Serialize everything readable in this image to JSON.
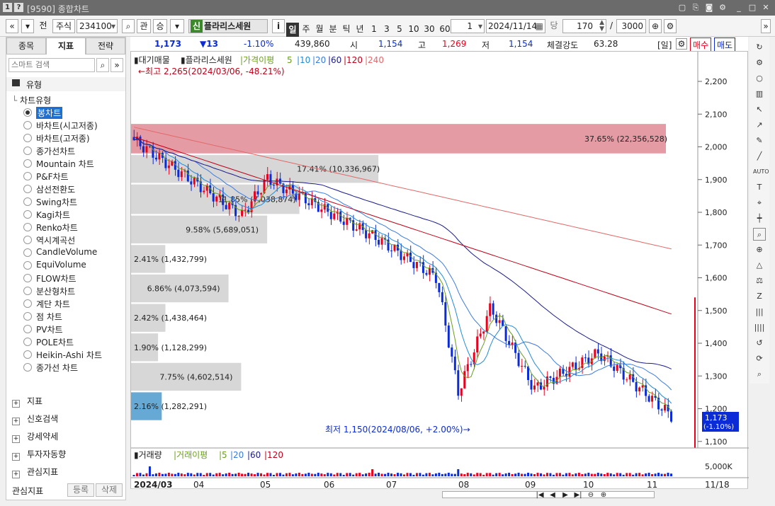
{
  "window": {
    "code": "[9590]",
    "title": "종합차트"
  },
  "toolbar": {
    "nav_prev": "«",
    "nav_down": "»",
    "chk_jeon": "전",
    "type": "주식",
    "code_value": "234100",
    "btn_gwan": "관",
    "btn_seung": "승",
    "stock_badge": "신",
    "stock_name": "플라리스세원",
    "info_btn": "i",
    "periods": [
      "일",
      "주",
      "월",
      "분",
      "틱",
      "년"
    ],
    "active_period": "일",
    "minutes": [
      "1",
      "3",
      "5",
      "10",
      "30",
      "60"
    ],
    "interval_value": "1",
    "date_value": "2024/11/14",
    "dang_label": "당",
    "count_value": "170",
    "slash": "/",
    "total_value": "3000"
  },
  "info": {
    "price": "1,173",
    "change": "▼13",
    "change_pct": "-1.10%",
    "volume": "439,860",
    "open_label": "시",
    "open": "1,154",
    "high_label": "고",
    "high": "1,269",
    "low_label": "저",
    "low": "1,154",
    "strength_label": "체결강도",
    "strength": "63.28",
    "period_tag": "[일]",
    "buy_btn": "매수",
    "sell_btn": "매도"
  },
  "left": {
    "tabs": [
      "종목",
      "지표",
      "전략"
    ],
    "active_tab": "지표",
    "search_placeholder": "스마트 검색",
    "section_type": "유형",
    "tree_root": "차트유형",
    "chart_types": [
      "봉차트",
      "바차트(시고저종)",
      "바차트(고저종)",
      "종가선차트",
      "Mountain 차트",
      "P&F차트",
      "삼선전환도",
      "Swing차트",
      "Kagi차트",
      "Renko차트",
      "역시계곡선",
      "CandleVolume",
      "EquiVolume",
      "FLOW차트",
      "분산형차트",
      "계단 차트",
      "점 차트",
      "PV차트",
      "POLE차트",
      "Heikin-Ashi 차트",
      "종가선 차트"
    ],
    "selected": "봉차트",
    "sections": [
      "지표",
      "신호검색",
      "강세약세",
      "투자자동향",
      "관심지표"
    ],
    "footer_label": "관심지표",
    "footer_add": "등록",
    "footer_del": "삭제"
  },
  "chart": {
    "legend": {
      "item1": "대기매물",
      "item2": "플라리스세원",
      "ma_label": "가격이평",
      "ma": [
        "5",
        "10",
        "20",
        "60",
        "120",
        "240"
      ]
    },
    "high_note": "←최고 2,265(2024/03/06, -48.21%)",
    "low_note": "최저 1,150(2024/08/06, +2.00%)→",
    "price_axis": [
      "2,200",
      "2,100",
      "2,000",
      "1,900",
      "1,800",
      "1,700",
      "1,600",
      "1,500",
      "1,400",
      "1,300",
      "1,200",
      "1,100"
    ],
    "current_tag": "1,173",
    "current_tag_pct": "(-1.10%)",
    "volume_profile": [
      {
        "price_from": 1980,
        "price_to": 2070,
        "pct_label": "37.65% (22,356,528)",
        "pct": 37.65,
        "highlight": "pink"
      },
      {
        "price_from": 1890,
        "price_to": 1975,
        "pct_label": "17.41% (10,336,967)",
        "pct": 17.41
      },
      {
        "price_from": 1795,
        "price_to": 1885,
        "pct_label": "11.85% (7,038,874)",
        "pct": 11.85
      },
      {
        "price_from": 1705,
        "price_to": 1790,
        "pct_label": "9.58% (5,689,051)",
        "pct": 9.58
      },
      {
        "price_from": 1615,
        "price_to": 1700,
        "pct_label": "2.41% (1,432,799)",
        "pct": 2.41
      },
      {
        "price_from": 1525,
        "price_to": 1610,
        "pct_label": "6.86% (4,073,594)",
        "pct": 6.86
      },
      {
        "price_from": 1435,
        "price_to": 1520,
        "pct_label": "2.42% (1,438,464)",
        "pct": 2.42
      },
      {
        "price_from": 1345,
        "price_to": 1430,
        "pct_label": "1.90% (1,128,299)",
        "pct": 1.9
      },
      {
        "price_from": 1255,
        "price_to": 1340,
        "pct_label": "7.75% (4,602,514)",
        "pct": 7.75
      },
      {
        "price_from": 1165,
        "price_to": 1250,
        "pct_label": "2.16% (1,282,291)",
        "pct": 2.16,
        "highlight": "blue"
      }
    ],
    "x_labels": [
      "2024/03",
      "04",
      "05",
      "06",
      "07",
      "08",
      "09",
      "10",
      "11",
      "11/18"
    ],
    "volume_legend": {
      "title": "거래량",
      "ma_label": "거래이평",
      "ma": [
        "5",
        "20",
        "60",
        "120"
      ],
      "axis": "5,000K"
    },
    "colors": {
      "up": "#e8001c",
      "down": "#0a2bd6",
      "ma5": "#6a9e1f",
      "ma10": "#1f8cd8",
      "ma20": "#3a7be0",
      "ma60": "#1a1a8a",
      "ma120": "#c00018",
      "ma240": "#e06a6a",
      "profile": "#d0d0d0",
      "profile_top": "#e08a94",
      "profile_cur": "#4a9acd"
    }
  },
  "bottom": {
    "nav_buttons": [
      "|◀",
      "◀",
      "▶",
      "▶|",
      "⊖",
      "⊕"
    ]
  }
}
